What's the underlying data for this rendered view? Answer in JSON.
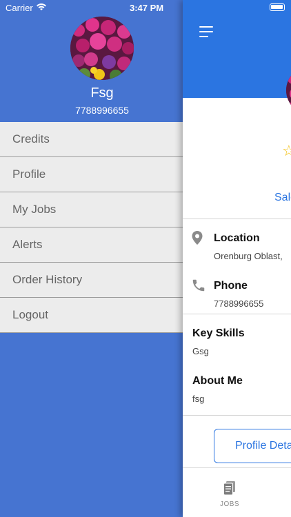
{
  "status_bar": {
    "carrier": "Carrier",
    "time": "3:47 PM"
  },
  "drawer": {
    "name": "Fsg",
    "phone": "7788996655",
    "menu": [
      {
        "label": "Credits"
      },
      {
        "label": "Profile"
      },
      {
        "label": "My Jobs"
      },
      {
        "label": "Alerts"
      },
      {
        "label": "Order History"
      },
      {
        "label": "Logout"
      }
    ]
  },
  "profile": {
    "sales_link": "Sale",
    "location": {
      "label": "Location",
      "value": "Orenburg Oblast,"
    },
    "phone": {
      "label": "Phone",
      "value": "7788996655"
    },
    "key_skills": {
      "label": "Key Skills",
      "value": "Gsg"
    },
    "about_me": {
      "label": "About Me",
      "value": "fsg"
    },
    "details_button": "Profile Deta"
  },
  "tabbar": {
    "jobs_label": "JOBS"
  },
  "colors": {
    "drawer_bg": "#4674d1",
    "header_bg": "#2b75e1",
    "menu_bg": "#ececec",
    "star": "#f3c21a"
  },
  "icons": [
    "wifi-icon",
    "hamburger-menu-icon",
    "battery-icon",
    "star-icon",
    "location-pin-icon",
    "phone-icon",
    "jobs-document-icon"
  ]
}
